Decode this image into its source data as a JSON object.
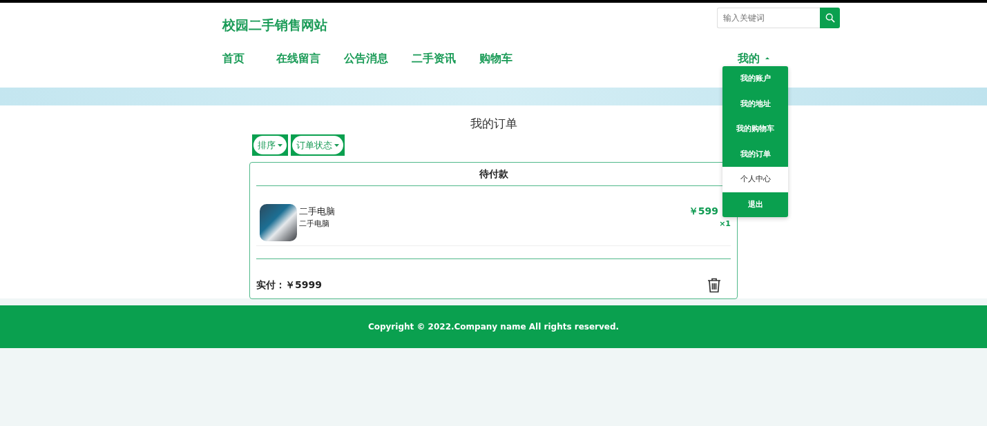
{
  "site_title": "校园二手销售网站",
  "search": {
    "placeholder": "输入关键词"
  },
  "nav": [
    {
      "label": "首页"
    },
    {
      "label": "在线留言"
    },
    {
      "label": "公告消息"
    },
    {
      "label": "二手资讯"
    },
    {
      "label": "购物车"
    }
  ],
  "user_menu": {
    "label": "我的",
    "expanded": true,
    "items": [
      {
        "label": "我的账户",
        "selected": false
      },
      {
        "label": "我的地址",
        "selected": false
      },
      {
        "label": "我的购物车",
        "selected": false
      },
      {
        "label": "我的订单",
        "selected": false
      },
      {
        "label": "个人中心",
        "selected": true
      },
      {
        "label": "退出",
        "selected": false
      }
    ]
  },
  "page_title": "我的订单",
  "filters": [
    {
      "label": "排序"
    },
    {
      "label": "订单状态"
    }
  ],
  "order": {
    "status": "待付款",
    "items": [
      {
        "name": "二手电脑",
        "description": "二手电脑",
        "price": "￥599",
        "quantity": "×1"
      }
    ],
    "total_label": "实付：",
    "total": "￥5999"
  },
  "footer": "Copyright © 2022.Company name All rights reserved."
}
